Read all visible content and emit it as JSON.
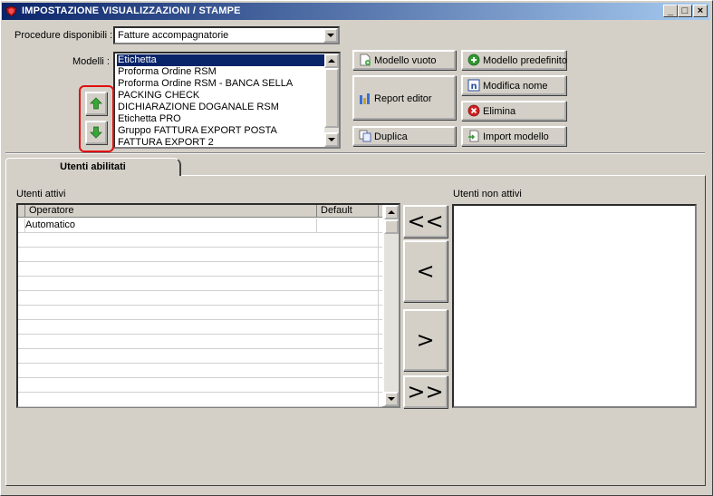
{
  "window": {
    "title": "IMPOSTAZIONE VISUALIZZAZIONI / STAMPE",
    "minimize": "_",
    "maximize": "□",
    "close": "×"
  },
  "procedure": {
    "label": "Procedure disponibili :",
    "selected": "Fatture accompagnatorie"
  },
  "models": {
    "label": "Modelli :",
    "items": [
      "Etichetta",
      "Proforma Ordine RSM",
      "Proforma Ordine RSM - BANCA SELLA",
      "PACKING CHECK",
      "DICHIARAZIONE DOGANALE RSM",
      "Etichetta PRO",
      "Gruppo FATTURA EXPORT POSTA",
      "FATTURA EXPORT 2"
    ],
    "selected_index": 0
  },
  "buttons": {
    "modello_vuoto": "Modello vuoto",
    "modello_predefinito": "Modello predefinito",
    "report_editor": "Report editor",
    "modifica_nome": "Modifica nome",
    "elimina": "Elimina",
    "duplica": "Duplica",
    "import_modello": "Import modello"
  },
  "tab": {
    "label": "Utenti abilitati"
  },
  "active_users": {
    "label": "Utenti attivi",
    "columns": [
      "Operatore",
      "Default"
    ],
    "rows": [
      {
        "operatore": "Automatico",
        "default": ""
      }
    ]
  },
  "inactive_users": {
    "label": "Utenti non attivi"
  },
  "transfer": {
    "all_left": "<<",
    "left": "<",
    "right": ">",
    "all_right": ">>"
  },
  "colors": {
    "title_start": "#0a246a",
    "title_end": "#a6caf0",
    "selection": "#0a246a",
    "highlight_box": "#e01010",
    "arrow_green": "#3aa63a"
  }
}
